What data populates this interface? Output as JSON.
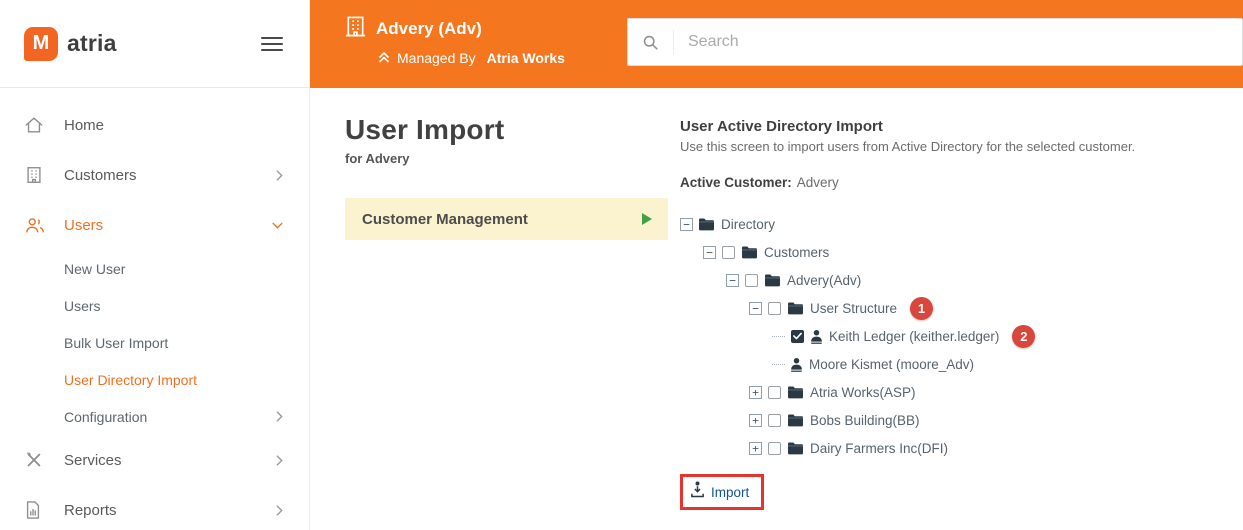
{
  "brand": {
    "name": "atria",
    "logo_letter": "M"
  },
  "sidebar": {
    "items": [
      {
        "id": "home",
        "label": "Home",
        "icon": "home-icon"
      },
      {
        "id": "customers",
        "label": "Customers",
        "icon": "building-icon",
        "chevron": "right"
      },
      {
        "id": "users",
        "label": "Users",
        "icon": "users-icon",
        "chevron": "down",
        "active": true
      },
      {
        "id": "new-user",
        "label": "New User",
        "sub": true
      },
      {
        "id": "users-list",
        "label": "Users",
        "sub": true
      },
      {
        "id": "bulk-user-import",
        "label": "Bulk User Import",
        "sub": true
      },
      {
        "id": "user-directory-import",
        "label": "User Directory Import",
        "sub": true,
        "active": true
      },
      {
        "id": "configuration",
        "label": "Configuration",
        "sub": true,
        "chevron": "right"
      },
      {
        "id": "services",
        "label": "Services",
        "icon": "services-icon",
        "chevron": "right"
      },
      {
        "id": "reports",
        "label": "Reports",
        "icon": "reports-icon",
        "chevron": "right"
      }
    ]
  },
  "header": {
    "customer_name": "Advery (Adv)",
    "managed_by_label": "Managed By",
    "managed_by_value": "Atria Works",
    "search_placeholder": "Search"
  },
  "main": {
    "page_title": "User Import",
    "page_subtitle": "for Advery",
    "menu_button_label": "Customer Management",
    "panel_title": "User Active Directory Import",
    "panel_description": "Use this screen to import users from Active Directory for the selected customer.",
    "active_customer_label": "Active Customer:",
    "active_customer_value": "Advery",
    "import_label": "Import",
    "tree": [
      {
        "depth": 0,
        "expander": "minus",
        "checkbox": null,
        "icon": "folder",
        "label": "Directory"
      },
      {
        "depth": 1,
        "expander": "minus",
        "checkbox": "unchecked",
        "icon": "folder",
        "label": "Customers"
      },
      {
        "depth": 2,
        "expander": "minus",
        "checkbox": "unchecked",
        "icon": "folder",
        "label": "Advery(Adv)"
      },
      {
        "depth": 3,
        "expander": "minus",
        "checkbox": "unchecked",
        "icon": "folder",
        "label": "User Structure",
        "badge": "1"
      },
      {
        "depth": 4,
        "expander": null,
        "checkbox": "checked",
        "icon": "user",
        "label": "Keith Ledger (keither.ledger)",
        "badge": "2"
      },
      {
        "depth": 4,
        "expander": null,
        "checkbox": null,
        "icon": "user",
        "label": "Moore Kismet (moore_Adv)"
      },
      {
        "depth": 3,
        "expander": "plus",
        "checkbox": "unchecked",
        "icon": "folder",
        "label": "Atria Works(ASP)"
      },
      {
        "depth": 3,
        "expander": "plus",
        "checkbox": "unchecked",
        "icon": "folder",
        "label": "Bobs Building(BB)"
      },
      {
        "depth": 3,
        "expander": "plus",
        "checkbox": "unchecked",
        "icon": "folder",
        "label": "Dairy Farmers Inc(DFI)"
      }
    ]
  },
  "colors": {
    "header_orange": "#f4771f",
    "logo_orange": "#f26522",
    "active_orange": "#ef7023",
    "highlight_yellow": "#fbf2cf",
    "badge_red": "#d8463c",
    "annotation_red": "#e3342f",
    "link_blue": "#15548b",
    "play_green": "#43a047",
    "tree_dark": "#2a3944"
  }
}
